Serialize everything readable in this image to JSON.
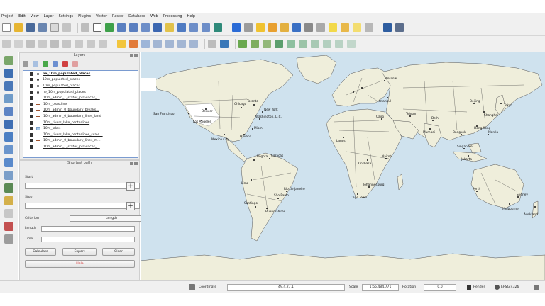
{
  "menu": [
    "Project",
    "Edit",
    "View",
    "Layer",
    "Settings",
    "Plugins",
    "Vector",
    "Raster",
    "Database",
    "Web",
    "Processing",
    "Help"
  ],
  "layers_panel": {
    "title": "Layers",
    "items": [
      {
        "name": "ne_10m_populated_places",
        "symbol": "point",
        "active": true
      },
      {
        "name": "10m_populated_places",
        "symbol": "point"
      },
      {
        "name": "10m_populated_places",
        "symbol": "point"
      },
      {
        "name": "ne_10m_populated_places",
        "symbol": "point"
      },
      {
        "name": "10m_admin_1_states_provinces_...",
        "symbol": "line"
      },
      {
        "name": "10m_coastline",
        "symbol": "line"
      },
      {
        "name": "10m_admin_0_boundary_breaks...",
        "symbol": "line"
      },
      {
        "name": "10m_admin_0_boundary_lines_land",
        "symbol": "line"
      },
      {
        "name": "10m_rivers_lake_centerlines",
        "symbol": "line"
      },
      {
        "name": "10m_lakes",
        "symbol": "poly"
      },
      {
        "name": "10m_rivers_lake_centerlines_scale...",
        "symbol": "line"
      },
      {
        "name": "10m_admin_0_boundary_lines_m...",
        "symbol": "line"
      },
      {
        "name": "10m_admin_1_states_provinces_...",
        "symbol": "line"
      }
    ]
  },
  "shortest_path": {
    "title": "Shortest path",
    "start_label": "Start",
    "stop_label": "Stop",
    "criterion_label": "Criterion",
    "criterion_value": "Length",
    "length_label": "Length",
    "time_label": "Time",
    "calculate_label": "Calculate",
    "export_label": "Export",
    "clear_label": "Clear",
    "help_label": "Help"
  },
  "map_labels": {
    "san_francisco": "San Francisco",
    "denver": "Denver",
    "los_angeles": "Los Angeles",
    "rio": "Rio de Janeiro",
    "sao_paulo": "São Paulo",
    "buenos_aires": "Buenos Aires",
    "santiago": "Santiago",
    "lima": "Lima",
    "bogota": "Bogota",
    "mexico_city": "Mexico City",
    "chicago": "Chicago",
    "toronto": "Toronto",
    "new_york": "New York",
    "washington": "Washington, D.C.",
    "miami": "Miami",
    "havana": "Havana",
    "caracas": "Caracas",
    "lagos": "Lagos",
    "kinshasa": "Kinshasa",
    "nairobi": "Nairobi",
    "johannesburg": "Johannesburg",
    "cape_town": "Cape Town",
    "cairo": "Cairo",
    "istanbul": "Istanbul",
    "moscow": "Moscow",
    "tehran": "Tehran",
    "mumbai": "Mumbai",
    "delhi": "Delhi",
    "beijing": "Beijing",
    "shanghai": "Shanghai",
    "tokyo": "Tokyo",
    "hong_kong": "Hong Kong",
    "bangkok": "Bangkok",
    "singapore": "Singapore",
    "jakarta": "Jakarta",
    "manila": "Manila",
    "sydney": "Sydney",
    "melbourne": "Melbourne",
    "perth": "Perth",
    "auckland": "Auckland"
  },
  "status": {
    "coordinate_label": "Coordinate",
    "coordinate_value": "49.4,27.1",
    "scale_label": "Scale",
    "scale_value": "1:55,484,771",
    "rotation_label": "Rotation",
    "rotation_value": "0.0",
    "render_label": "Render",
    "epsg_label": "EPSG:4326"
  },
  "colors": {
    "ocean": "#cfe2ee",
    "land": "#efeedb",
    "highlight": "#ffffff",
    "toolbar": "#f0f0f0"
  }
}
